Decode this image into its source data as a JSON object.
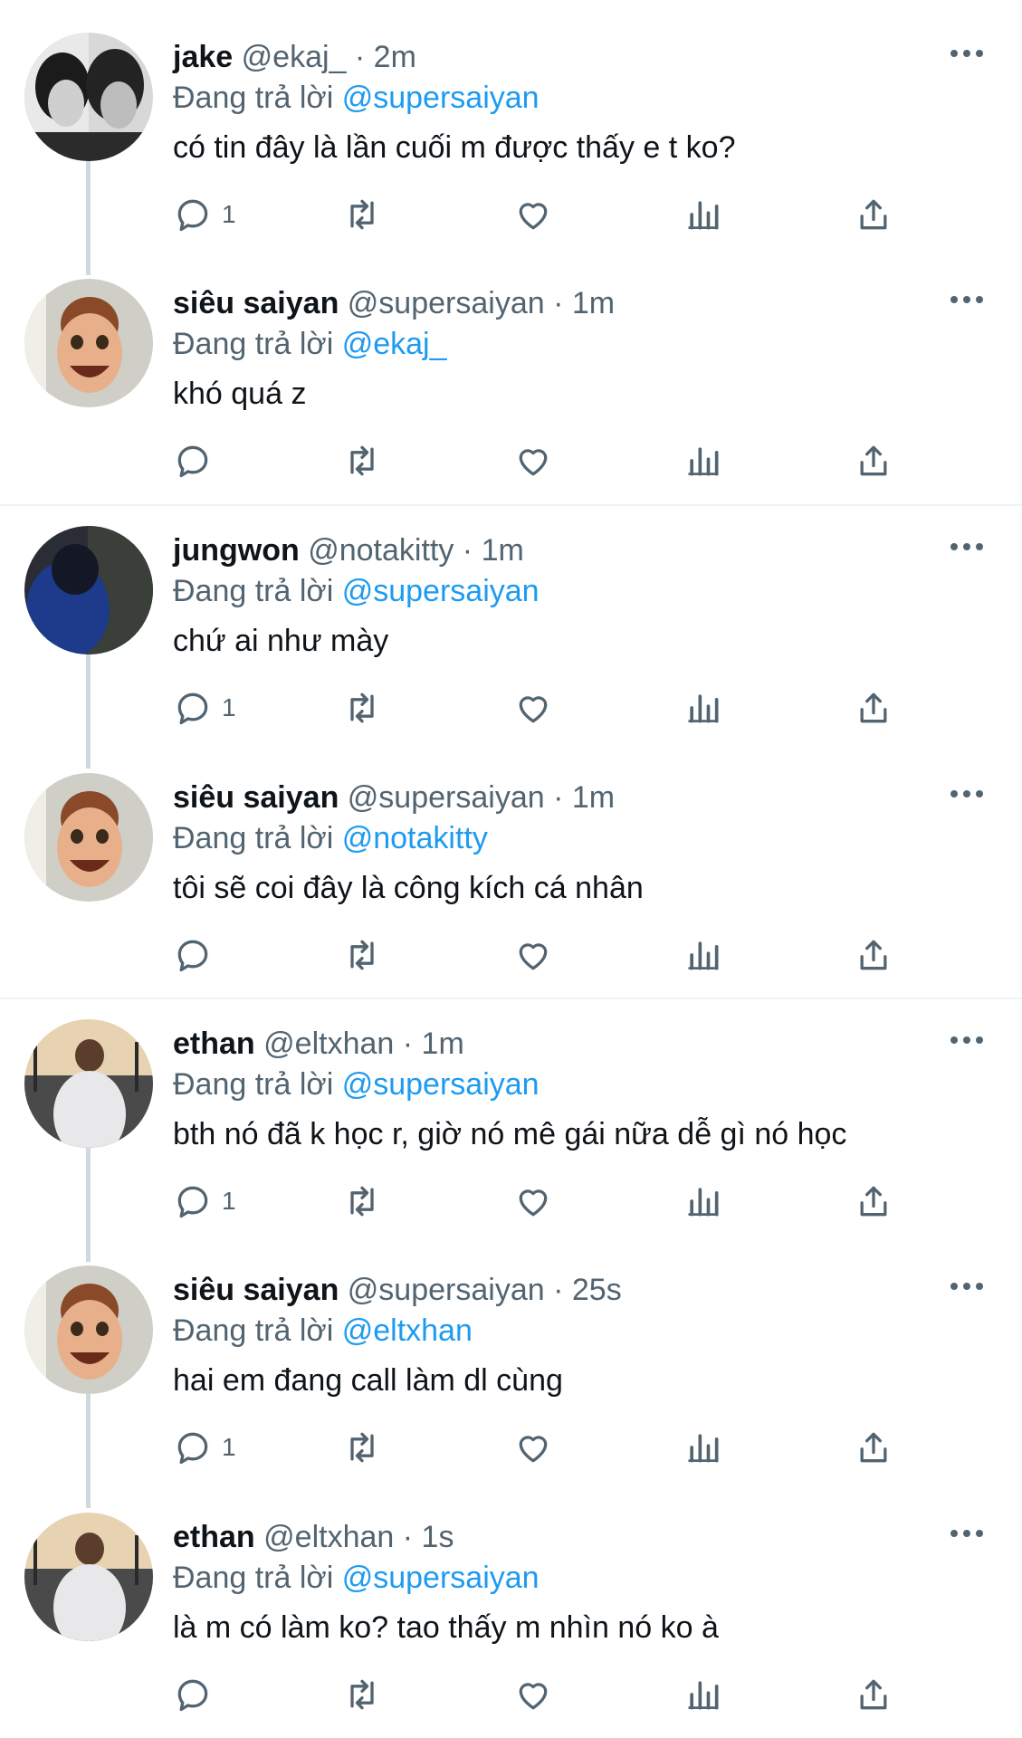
{
  "tweets": [
    {
      "name": "jake",
      "handle": "@ekaj_",
      "sep": "·",
      "time": "2m",
      "reply_prefix": "Đang trả lời",
      "reply_to": "@supersaiyan",
      "text": "có tin đây là lần cuối m được thấy e t ko?",
      "reply_count": "1",
      "avatar": "photo-two-people-avatar"
    },
    {
      "name": "siêu saiyan",
      "handle": "@supersaiyan",
      "sep": "·",
      "time": "1m",
      "reply_prefix": "Đang trả lời",
      "reply_to": "@ekaj_",
      "text": "khó quá z",
      "reply_count": "",
      "avatar": "cartoon-face-avatar"
    },
    {
      "name": "jungwon",
      "handle": "@notakitty",
      "sep": "·",
      "time": "1m",
      "reply_prefix": "Đang trả lời",
      "reply_to": "@supersaiyan",
      "text": "chứ ai như mày",
      "reply_count": "1",
      "avatar": "dark-blue-hoodie-avatar"
    },
    {
      "name": "siêu saiyan",
      "handle": "@supersaiyan",
      "sep": "·",
      "time": "1m",
      "reply_prefix": "Đang trả lời",
      "reply_to": "@notakitty",
      "text": "tôi sẽ coi đây là công kích cá nhân",
      "reply_count": "",
      "avatar": "cartoon-face-avatar"
    },
    {
      "name": "ethan",
      "handle": "@eltxhan",
      "sep": "·",
      "time": "1m",
      "reply_prefix": "Đang trả lời",
      "reply_to": "@supersaiyan",
      "text": "bth nó đã k học r, giờ nó mê gái nữa dễ gì nó học",
      "reply_count": "1",
      "avatar": "person-back-view-avatar"
    },
    {
      "name": "siêu saiyan",
      "handle": "@supersaiyan",
      "sep": "·",
      "time": "25s",
      "reply_prefix": "Đang trả lời",
      "reply_to": "@eltxhan",
      "text": "hai em đang call làm dl cùng",
      "reply_count": "1",
      "avatar": "cartoon-face-avatar"
    },
    {
      "name": "ethan",
      "handle": "@eltxhan",
      "sep": "·",
      "time": "1s",
      "reply_prefix": "Đang trả lời",
      "reply_to": "@supersaiyan",
      "text": "là m có làm ko? tao thấy m nhìn nó ko à",
      "reply_count": "",
      "avatar": "person-back-view-avatar"
    }
  ],
  "icons": {
    "reply": "reply-bubble-icon",
    "retweet": "retweet-icon",
    "like": "heart-icon",
    "views": "views-bar-chart-icon",
    "share": "share-upload-icon",
    "more": "more-dots-icon"
  },
  "colors": {
    "mention": "#1d9bf0",
    "secondary_text": "#536471",
    "primary_text": "#0f1419",
    "thread_line": "#cfd9de",
    "divider": "#eff3f4"
  }
}
